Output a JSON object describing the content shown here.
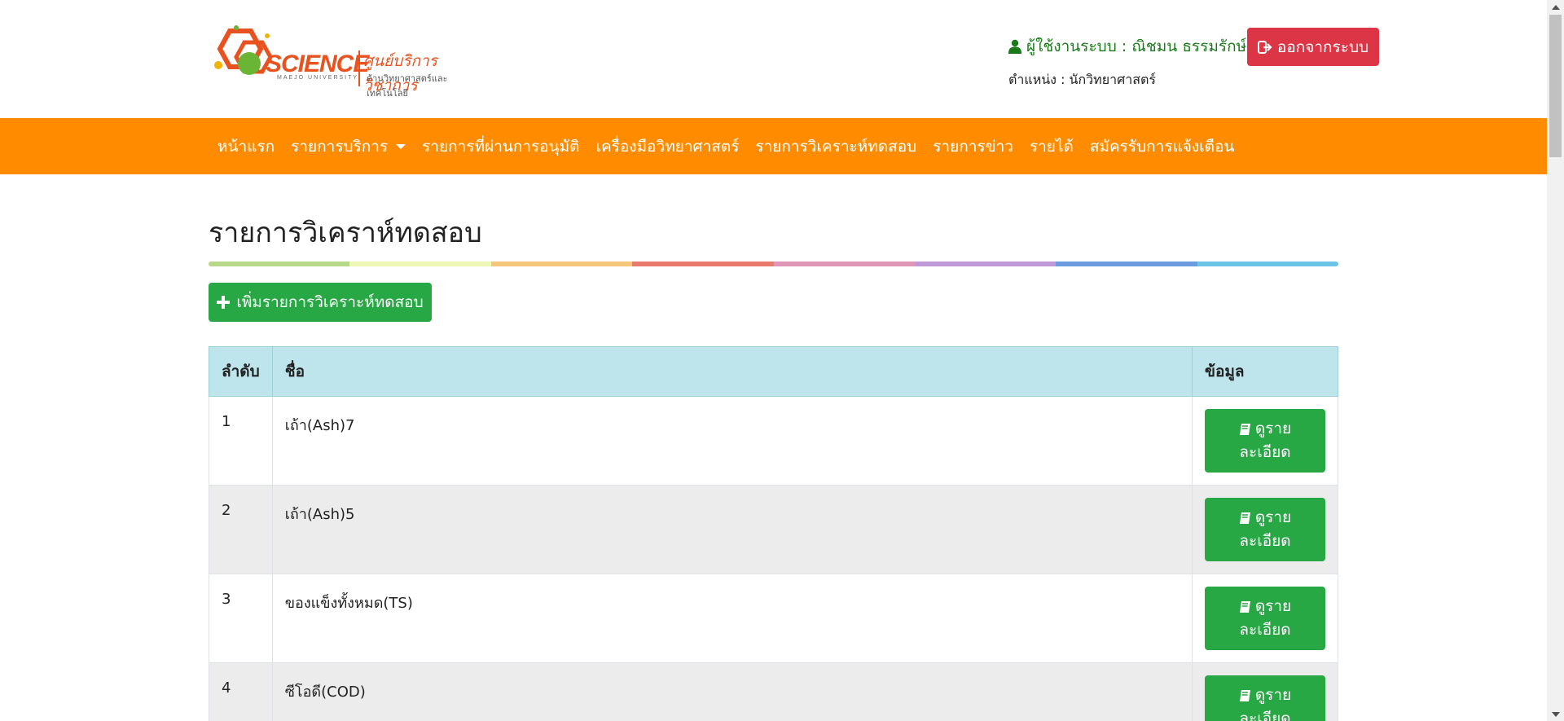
{
  "header": {
    "logo": {
      "science_text": "SCIENCE",
      "sub_text": "MAEJO UNIVERSITY",
      "thai_title": "ศูนย์บริการวิชาการ",
      "thai_subtitle": "ด้านวิทยาศาสตร์และเทคโนโลยี"
    },
    "user_label": "ผู้ใช้งานระบบ : ณิชมน ธรรมรักษ์",
    "position_label": "ตำแหน่ง : นักวิทยาศาสตร์",
    "logout_label": "ออกจากระบบ"
  },
  "nav": {
    "items": [
      {
        "label": "หน้าแรก"
      },
      {
        "label": "รายการบริการ"
      },
      {
        "label": "รายการที่ผ่านการอนุมัติ"
      },
      {
        "label": "เครื่องมือวิทยาศาสตร์"
      },
      {
        "label": "รายการวิเคราะห์ทดสอบ"
      },
      {
        "label": "รายการข่าว"
      },
      {
        "label": "รายได้"
      },
      {
        "label": "สมัครรับการแจ้งเตือน"
      }
    ]
  },
  "main": {
    "title": "รายการวิเคราห์ทดสอบ",
    "add_button": "เพิ่มรายการวิเคราะห์ทดสอบ",
    "table": {
      "headers": [
        "ลำดับ",
        "ชื่อ",
        "ข้อมูล"
      ],
      "rows": [
        {
          "no": "1",
          "name": "เถ้า(Ash)7"
        },
        {
          "no": "2",
          "name": "เถ้า(Ash)5"
        },
        {
          "no": "3",
          "name": "ของแข็งทั้งหมด(TS)"
        },
        {
          "no": "4",
          "name": "ซีโอดี(COD)"
        }
      ],
      "detail_button_line1": "ดูราย",
      "detail_button_line2": "ละเอียด"
    },
    "rainbow_colors": [
      "#b8d98a",
      "#eef7b5",
      "#f5c77a",
      "#e87b6e",
      "#e096b8",
      "#c09ad8",
      "#6c9be0",
      "#6cc4e6"
    ]
  },
  "colors": {
    "navbar": "#ff8c00",
    "logout": "#dc3545",
    "success": "#28a745",
    "table_header": "#bee5eb"
  }
}
